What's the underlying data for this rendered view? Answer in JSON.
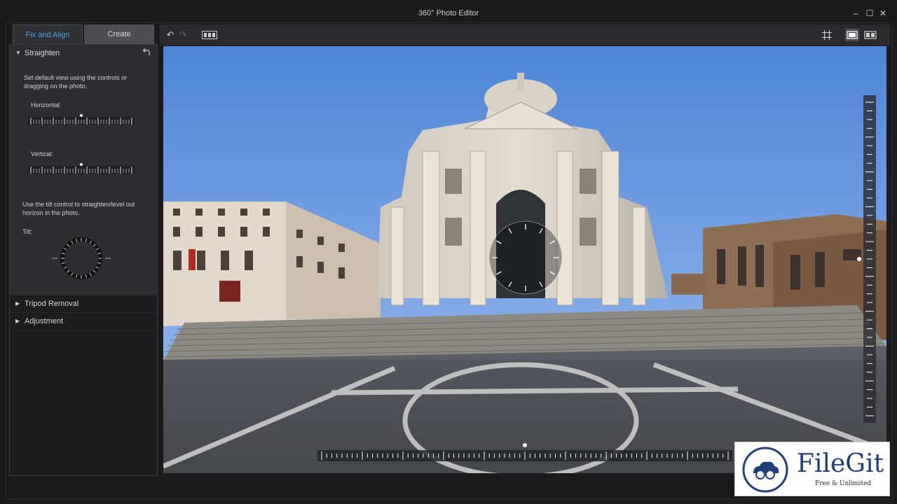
{
  "window": {
    "title": "360° Photo Editor"
  },
  "window_controls": [
    "minimize-icon",
    "maximize-icon",
    "close-icon"
  ],
  "tabs": {
    "fix_align": "Fix and Align",
    "create": "Create"
  },
  "straighten": {
    "title": "Straighten",
    "help": "Set default view using the controls or dragging on the photo.",
    "horizontal_label": "Horizontal:",
    "vertical_label": "Vertical:",
    "tilt_help": "Use the tilt control to straighten/level out horizon in the photo.",
    "tilt_label": "Tilt:",
    "horizontal_value": 0.5,
    "vertical_value": 0.5
  },
  "sections": {
    "tripod": "Tripod Removal",
    "adjustment": "Adjustment"
  },
  "toolbar_icons": [
    "undo-icon",
    "redo-icon",
    "compare-icon",
    "grid-icon",
    "single-view-icon",
    "split-view-icon"
  ],
  "colors": {
    "accent": "#4aa8e8",
    "panel": "#2d2e32",
    "background": "#1b1b1e"
  },
  "overlay": {
    "horizontal_slider_value": 0.5,
    "vertical_slider_value": 0.5
  },
  "watermark": {
    "title": "FileGit",
    "subtitle": "Free & Unlimited"
  }
}
